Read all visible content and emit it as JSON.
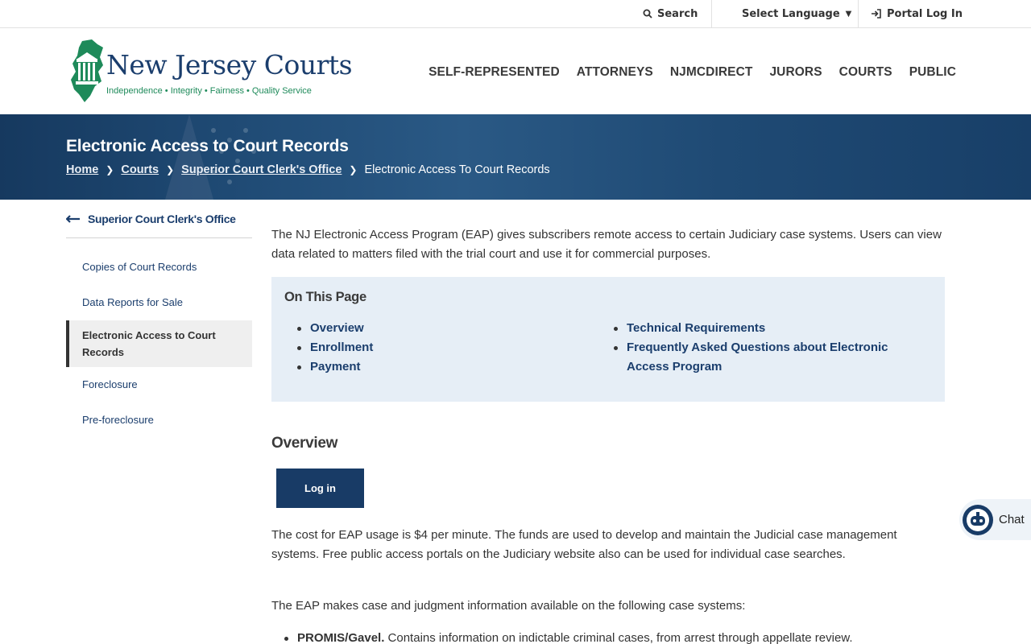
{
  "utility": {
    "search_label": "Search",
    "language_label": "Select Language",
    "portal_label": "Portal Log In"
  },
  "logo": {
    "title": "New Jersey Courts",
    "tagline": "Independence • Integrity • Fairness • Quality Service"
  },
  "nav": {
    "items": [
      {
        "label": "SELF-REPRESENTED"
      },
      {
        "label": "ATTORNEYS"
      },
      {
        "label": "NJMCDIRECT"
      },
      {
        "label": "JURORS"
      },
      {
        "label": "COURTS"
      },
      {
        "label": "PUBLIC"
      }
    ]
  },
  "banner": {
    "title": "Electronic Access to Court Records",
    "breadcrumb": {
      "home": "Home",
      "courts": "Courts",
      "clerk": "Superior Court Clerk's Office",
      "current": "Electronic Access To Court Records"
    }
  },
  "sidebar": {
    "back_label": "Superior Court Clerk's Office",
    "items": [
      {
        "label": "Copies of Court Records"
      },
      {
        "label": "Data Reports for Sale"
      },
      {
        "label": "Electronic Access to Court Records"
      },
      {
        "label": "Foreclosure"
      },
      {
        "label": "Pre-foreclosure"
      }
    ]
  },
  "content": {
    "intro": "The NJ Electronic Access Program (EAP) gives subscribers remote access to certain Judiciary case systems. Users can view data related to matters filed with the trial court and use it for commercial purposes.",
    "on_this_page": {
      "title": "On This Page",
      "col1": [
        "Overview",
        "Enrollment",
        "Payment"
      ],
      "col2": [
        "Technical Requirements",
        "Frequently Asked Questions about Electronic Access Program"
      ]
    },
    "overview_heading": "Overview",
    "login_button": "Log in",
    "cost_text": "The cost for EAP usage is $4 per minute. The funds are used to develop and maintain the Judicial case management systems. Free public access portals on the Judiciary website also can be used for individual case searches.",
    "eap_text": "The EAP makes case and judgment information available on the following case systems:",
    "systems": [
      {
        "name": "PROMIS/Gavel.",
        "desc": " Contains information on indictable criminal cases, from arrest through appellate review."
      }
    ]
  },
  "chat": {
    "label": "Chat"
  },
  "colors": {
    "brand_navy": "#1b3e6d",
    "banner": "#1f4a74",
    "logo_green": "#1e8a5a",
    "otp_bg": "#e6eef6",
    "button": "#183b66"
  }
}
